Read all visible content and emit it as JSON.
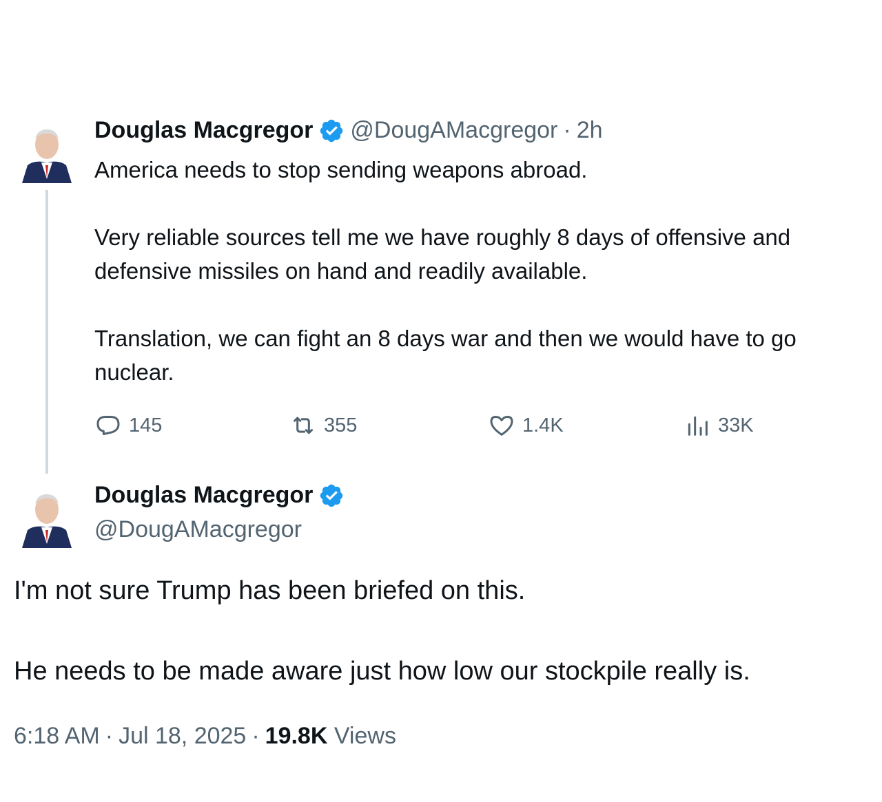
{
  "quoted_tweet": {
    "author_name": "Douglas Macgregor",
    "author_handle": "@DougAMacgregor",
    "time_separator": "·",
    "time_ago": "2h",
    "text": "America needs to stop sending weapons abroad.\n\nVery reliable sources tell me we have roughly 8 days of offensive and\ndefensive missiles on hand and readily available.\n\nTranslation, we can fight an 8 days war and then we would have to go\nnuclear.",
    "replies": "145",
    "reposts": "355",
    "likes": "1.4K",
    "views": "33K"
  },
  "main_tweet": {
    "author_name": "Douglas Macgregor",
    "author_handle": "@DougAMacgregor",
    "paragraph_1": "I'm not sure Trump has been briefed on this.",
    "paragraph_2": "He needs to be made aware just how low our stockpile really is.",
    "time": "6:18 AM",
    "date": "Jul 18, 2025",
    "separator": "·",
    "view_count": "19.8K",
    "views_label": "Views"
  },
  "colors": {
    "verified": "#1d9bf0",
    "muted_text": "#536471",
    "thread_line": "#cfd9de"
  }
}
